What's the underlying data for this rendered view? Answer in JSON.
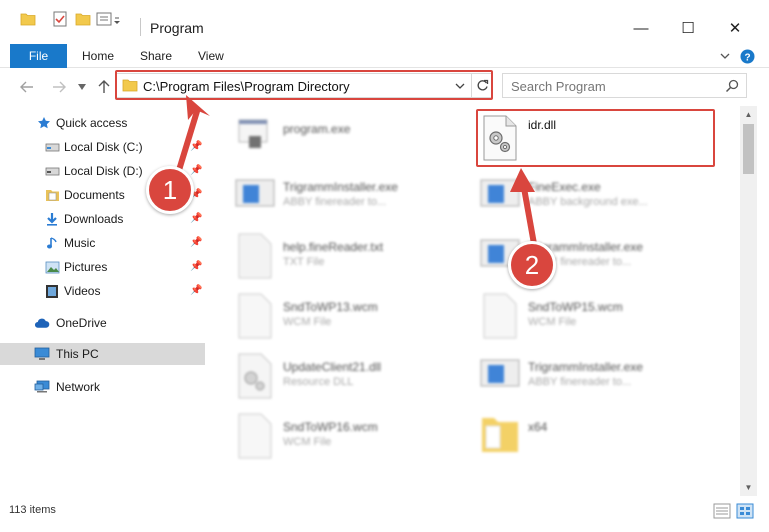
{
  "window": {
    "title": "Program",
    "minimize": "—",
    "maximize": "☐",
    "close": "✕"
  },
  "ribbon": {
    "tabs": [
      "File",
      "Home",
      "Share",
      "View"
    ]
  },
  "navigation": {
    "address": "C:\\Program Files\\Program Directory",
    "search_placeholder": "Search Program"
  },
  "sidebar": {
    "items": [
      {
        "label": "Quick access",
        "icon": "star-icon",
        "pinned": false
      },
      {
        "label": "Local Disk (C:)",
        "icon": "drive-icon",
        "pinned": true
      },
      {
        "label": "Local Disk (D:)",
        "icon": "drive-icon",
        "pinned": true
      },
      {
        "label": "Documents",
        "icon": "documents-icon",
        "pinned": true
      },
      {
        "label": "Downloads",
        "icon": "download-icon",
        "pinned": true
      },
      {
        "label": "Music",
        "icon": "music-icon",
        "pinned": true
      },
      {
        "label": "Pictures",
        "icon": "pictures-icon",
        "pinned": true
      },
      {
        "label": "Videos",
        "icon": "videos-icon",
        "pinned": true
      },
      {
        "label": "OneDrive",
        "icon": "cloud-icon",
        "pinned": false
      },
      {
        "label": "This PC",
        "icon": "computer-icon",
        "pinned": false,
        "selected": true
      },
      {
        "label": "Network",
        "icon": "network-icon",
        "pinned": false
      }
    ]
  },
  "files": [
    {
      "name": "program.exe",
      "type": "",
      "icon": "exe-icon"
    },
    {
      "name": "idr.dll",
      "type": "",
      "icon": "dll-gear-icon"
    },
    {
      "name": "TrigrammInstaller.exe",
      "type": "ABBY finereader to...",
      "icon": "installer-icon"
    },
    {
      "name": "FineExec.exe",
      "type": "ABBY background exe...",
      "icon": "installer-icon"
    },
    {
      "name": "help.fineReader.txt",
      "type": "TXT File",
      "icon": "text-file-icon"
    },
    {
      "name": "TrigrammInstaller.exe",
      "type": "ABBY finereader to...",
      "icon": "installer-icon"
    },
    {
      "name": "SndToWP13.wcm",
      "type": "WCM File",
      "icon": "blank-file-icon"
    },
    {
      "name": "SndToWP15.wcm",
      "type": "WCM File",
      "icon": "blank-file-icon"
    },
    {
      "name": "UpdateClient21.dll",
      "type": "Resource DLL",
      "icon": "dll-gear-icon"
    },
    {
      "name": "TrigrammInstaller.exe",
      "type": "ABBY finereader to...",
      "icon": "installer-icon"
    },
    {
      "name": "SndToWP16.wcm",
      "type": "WCM File",
      "icon": "blank-file-icon"
    },
    {
      "name": "x64",
      "type": "",
      "icon": "folder-icon"
    }
  ],
  "status": {
    "item_count": "113 items"
  },
  "annotations": {
    "callout_1": "1",
    "callout_2": "2",
    "color": "#d9463e"
  }
}
